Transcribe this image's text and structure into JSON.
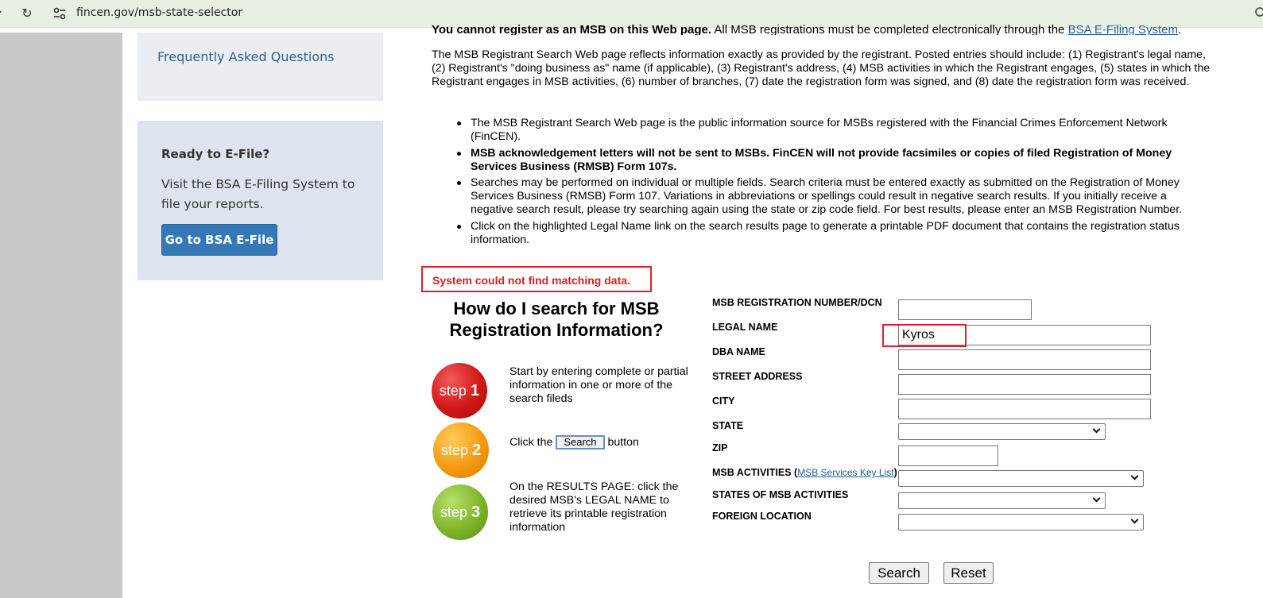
{
  "browser": {
    "url": "fincen.gov/msb-state-selector",
    "reload_icon": "↻"
  },
  "sidebar": {
    "faq_link": "Frequently Asked Questions",
    "efile": {
      "heading": "Ready to E-File?",
      "text": "Visit the BSA E-Filing System to file your reports.",
      "button": "Go to BSA E-File"
    }
  },
  "main": {
    "clipped_warning_bold": "You cannot register as an MSB on this Web page.",
    "clipped_warning_rest": " All MSB registrations must be completed electronically through the ",
    "clipped_warning_link": "BSA E-Filing System",
    "intro": "The MSB Registrant Search Web page reflects information exactly as provided by the registrant. Posted entries should include: (1) Registrant's legal name, (2) Registrant's \"doing business as\" name (if applicable), (3) Registrant's address, (4) MSB activities in which the Registrant engages, (5) states in which the Registrant engages in MSB activities, (6) number of branches, (7) date the registration form was signed, and (8) date the registration form was received.",
    "bullets": [
      "The MSB Registrant Search Web page is the public information source for MSBs registered with the Financial Crimes Enforcement Network (FinCEN).",
      "MSB acknowledgement letters will not be sent to MSBs. FinCEN will not provide facsimiles or copies of filed Registration of Money Services Business (RMSB) Form 107s.",
      "Searches may be performed on individual or multiple fields. Search criteria must be entered exactly as submitted on the Registration of Money Services Business (RMSB) Form 107. Variations in abbreviations or spellings could result in negative search results. If you initially receive a negative search result, please try searching again using the state or zip code field. For best results, please enter an MSB Registration Number.",
      "Click on the highlighted Legal Name link on the search results page to generate a printable PDF document that contains the registration status information."
    ],
    "error_message": "System could not find matching data.",
    "howto_title": "How do I search for MSB Registration Information?",
    "steps": [
      {
        "word": "step",
        "number": "1",
        "color": "#d21717",
        "text": "Start by entering complete or partial information in one or more of the search fileds"
      },
      {
        "word": "step",
        "number": "2",
        "color": "#f59a10",
        "text_before": "Click the ",
        "button": "Search",
        "text_after": " button"
      },
      {
        "word": "step",
        "number": "3",
        "color": "#7eb52a",
        "text": "On the RESULTS PAGE: click the desired MSB's LEGAL NAME to retrieve its printable registration information"
      }
    ]
  },
  "form": {
    "labels": {
      "registration_number": "MSB REGISTRATION NUMBER/DCN",
      "legal_name": "LEGAL NAME",
      "dba_name": "DBA NAME",
      "street_address": "STREET ADDRESS",
      "city": "CITY",
      "state": "STATE",
      "zip": "ZIP",
      "msb_activities": "MSB ACTIVITIES",
      "msb_activities_open": " (",
      "msb_services_link": "MSB Services Key List",
      "msb_activities_close": ")",
      "states_of_activities": "STATES OF MSB ACTIVITIES",
      "foreign_location": "FOREIGN LOCATION"
    },
    "values": {
      "registration_number": "",
      "legal_name": "Kyros",
      "dba_name": "",
      "street_address": "",
      "city": "",
      "zip": ""
    },
    "search_button": "Search",
    "reset_button": "Reset"
  }
}
